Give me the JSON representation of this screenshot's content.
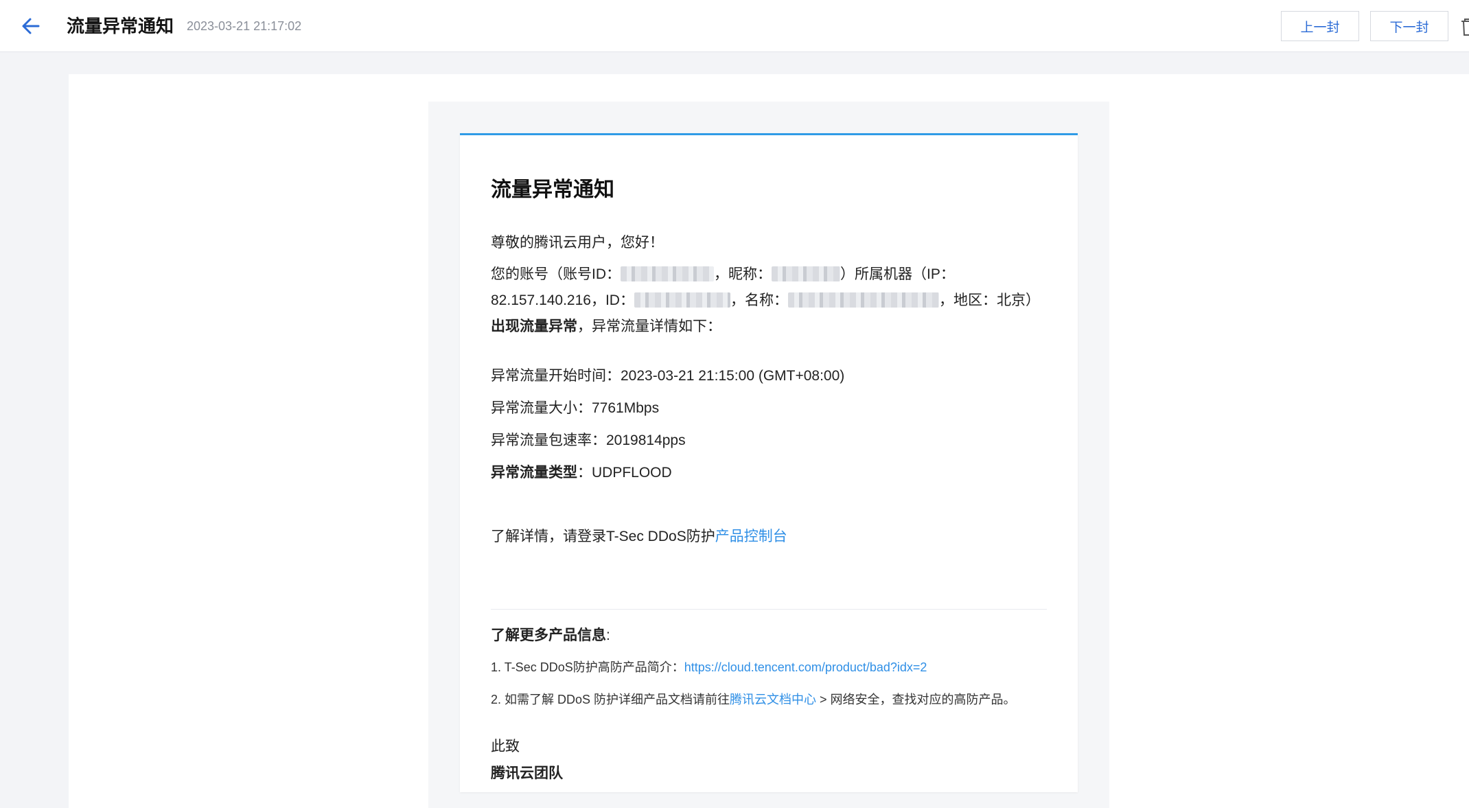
{
  "header": {
    "title": "流量异常通知",
    "date": "2023-03-21 21:17:02",
    "prev_label": "上一封",
    "next_label": "下一封"
  },
  "mail": {
    "title": "流量异常通知",
    "greeting": "尊敬的腾讯云用户，您好！",
    "account_text_1": "您的账号（账号ID：",
    "account_text_2": "，昵称：",
    "account_text_3": "）所属机器（IP：82.157.140.216，ID：",
    "account_text_4": "，名称：",
    "account_text_5": "，地区：北京）",
    "account_strong": "出现流量异常",
    "account_text_6": "，异常流量详情如下：",
    "start_time": "异常流量开始时间：2023-03-21 21:15:00 (GMT+08:00)",
    "size": "异常流量大小：7761Mbps",
    "pps": "异常流量包速率：2019814pps",
    "type_label": "异常流量类型",
    "type_value": "：UDPFLOOD",
    "more_text": "了解详情，请登录T-Sec DDoS防护",
    "more_link": "产品控制台",
    "info_heading": "了解更多产品信息",
    "info_colon": ":",
    "item1_text": "1. T-Sec DDoS防护高防产品简介：",
    "item1_link": "https://cloud.tencent.com/product/bad?idx=2",
    "item2_text": "2. 如需了解 DDoS 防护详细产品文档请前往",
    "item2_link": "腾讯云文档中心",
    "item2_tail": " > 网络安全，查找对应的高防产品。",
    "closing": "此致",
    "signature": "腾讯云团队"
  },
  "colors": {
    "accent": "#2b6bd6",
    "link": "#2f8fe6",
    "card_top_border": "#2f9be6"
  },
  "icons": {
    "back": "arrow-left-icon",
    "trash": "trash-icon"
  }
}
